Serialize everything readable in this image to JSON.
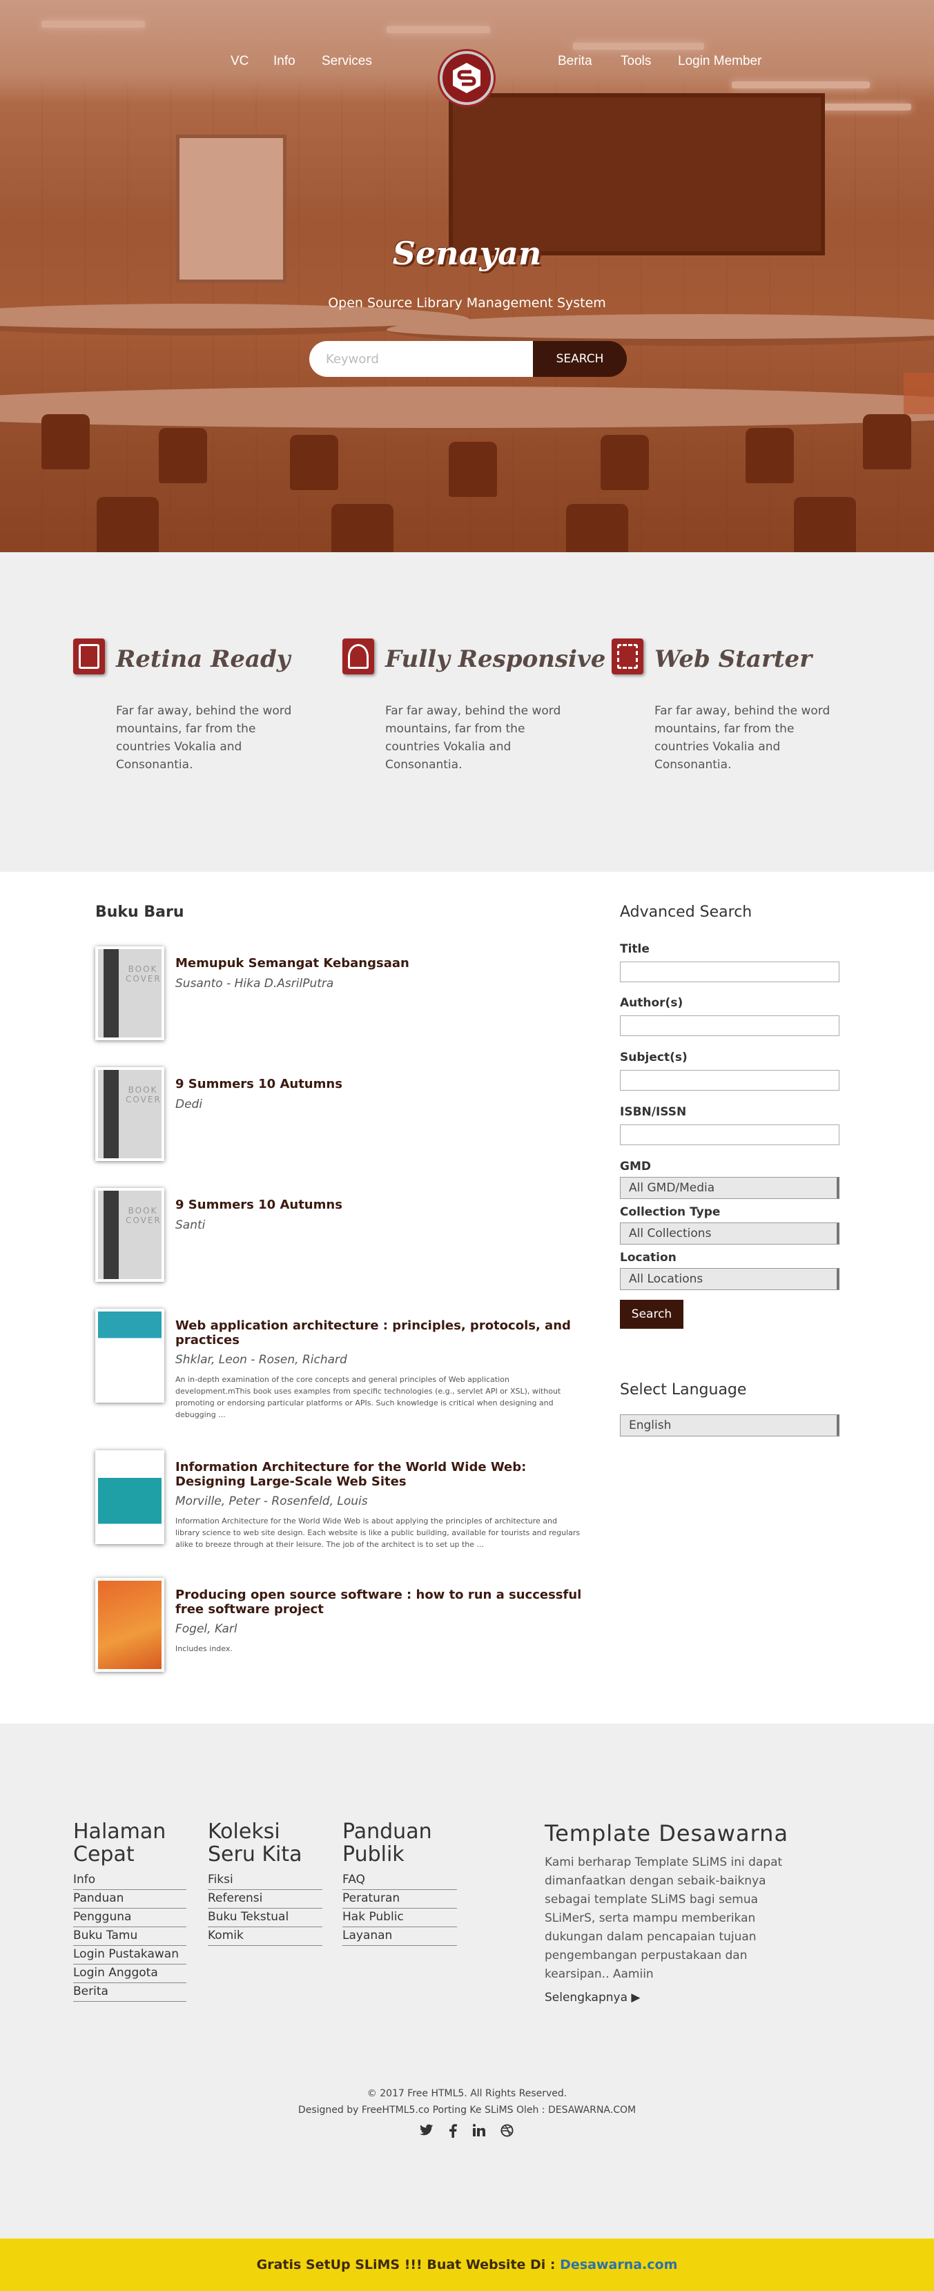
{
  "nav": {
    "left": [
      "VC",
      "Info",
      "Services"
    ],
    "right": [
      "Berita",
      "Tools",
      "Login Member"
    ]
  },
  "hero": {
    "title": "Senayan",
    "subtitle": "Open Source Library Management System",
    "search_placeholder": "Keyword",
    "search_button": "SEARCH"
  },
  "features": [
    {
      "title": "Retina Ready",
      "icon": "book-icon",
      "text": "Far far away, behind the word mountains, far from the countries Vokalia and Consonantia."
    },
    {
      "title": "Fully Responsive",
      "icon": "user-icon",
      "text": "Far far away, behind the word mountains, far from the countries Vokalia and Consonantia."
    },
    {
      "title": "Web Starter",
      "icon": "barcode-icon",
      "text": "Far far away, behind the word mountains, far from the countries Vokalia and Consonantia."
    }
  ],
  "buku_baru": {
    "title": "Buku Baru",
    "cover_placeholder": "BOOK COVER",
    "books": [
      {
        "title": "Memupuk Semangat Kebangsaan",
        "author": "Susanto - Hika D.AsrilPutra",
        "desc": ""
      },
      {
        "title": "9 Summers 10 Autumns",
        "author": "Dedi",
        "desc": ""
      },
      {
        "title": "9 Summers 10 Autumns",
        "author": "Santi",
        "desc": ""
      },
      {
        "title": "Web application architecture : principles, protocols, and practices",
        "author": "Shklar, Leon - Rosen, Richard",
        "desc": "An in-depth examination of the core concepts and general principles of Web application development.mThis book uses examples from specific technologies (e.g., servlet API or XSL), without promoting or endorsing particular platforms or APIs. Such knowledge is critical when designing and debugging ..."
      },
      {
        "title": "Information Architecture for the World Wide Web: Designing Large-Scale Web Sites",
        "author": "Morville, Peter - Rosenfeld, Louis",
        "desc": "Information Architecture for the World Wide Web is about applying the principles of architecture and library science to web site design. Each website is like a public building, available for tourists and regulars alike to breeze through at their leisure. The job of the architect is to set up the ..."
      },
      {
        "title": "Producing open source software : how to run a successful free software project",
        "author": "Fogel, Karl",
        "desc": "Includes index."
      }
    ]
  },
  "advanced_search": {
    "title": "Advanced Search",
    "title_label": "Title",
    "authors_label": "Author(s)",
    "subjects_label": "Subject(s)",
    "isbn_label": "ISBN/ISSN",
    "gmd_label": "GMD",
    "gmd_value": "All GMD/Media",
    "collection_label": "Collection Type",
    "collection_value": "All Collections",
    "location_label": "Location",
    "location_value": "All Locations",
    "search_button": "Search"
  },
  "language": {
    "title": "Select Language",
    "value": "English"
  },
  "footer": {
    "cols": [
      {
        "title": "Halaman Cepat",
        "items": [
          "Info",
          "Panduan",
          "Pengguna",
          "Buku Tamu",
          "Login Pustakawan",
          "Login Anggota",
          "Berita"
        ]
      },
      {
        "title": "Koleksi Seru Kita",
        "items": [
          "Fiksi",
          "Referensi",
          "Buku Tekstual",
          "Komik"
        ]
      },
      {
        "title": "Panduan Publik",
        "items": [
          "FAQ",
          "Peraturan",
          "Hak Public",
          "Layanan"
        ]
      }
    ],
    "template": {
      "title": "Template Desawarna",
      "text": "Kami berharap Template SLiMS ini dapat dimanfaatkan dengan sebaik-baiknya sebagai template SLiMS bagi semua SLiMerS, serta mampu memberikan dukungan dalam pencapaian tujuan pengembangan perpustakaan dan kearsipan.. Aamiin",
      "more": "Selengkapnya ▶"
    },
    "copyright": "© 2017 Free HTML5. All Rights Reserved.",
    "designed": "Designed by FreeHTML5.co Porting Ke SLiMS Oleh : DESAWARNA.COM",
    "social": [
      "twitter-icon",
      "facebook-icon",
      "linkedin-icon",
      "dribbble-icon"
    ]
  },
  "bottom_bar": {
    "text": "Gratis SetUp SLiMS !!! Buat Website Di : ",
    "link": "Desawarna.com",
    "accent": "#f2d40a"
  },
  "colors": {
    "brand": "#9e2323",
    "dark_button": "#3d160b",
    "title_text": "#3b1a10"
  }
}
